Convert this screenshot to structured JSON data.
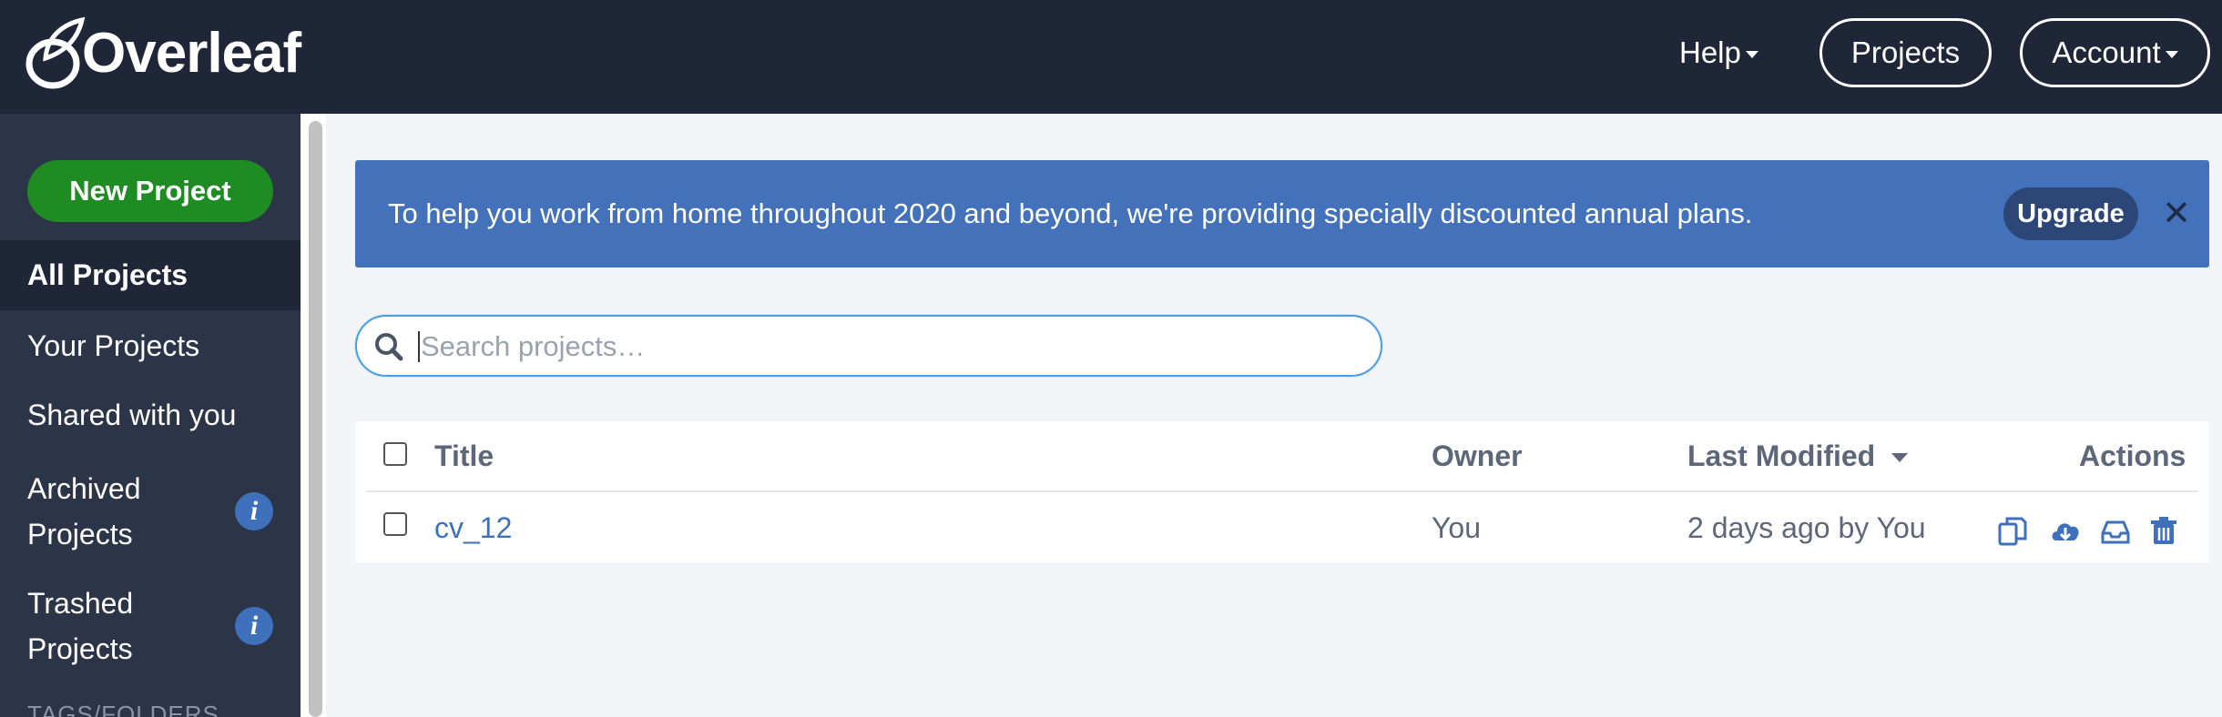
{
  "header": {
    "logo_text": "Overleaf",
    "help_label": "Help",
    "projects_label": "Projects",
    "account_label": "Account"
  },
  "sidebar": {
    "new_project_label": "New Project",
    "items": [
      {
        "label": "All Projects",
        "active": true
      },
      {
        "label": "Your Projects"
      },
      {
        "label": "Shared with you"
      },
      {
        "label": "Archived Projects",
        "info": "i"
      },
      {
        "label": "Trashed Projects",
        "info": "i"
      }
    ],
    "tags_heading": "TAGS/FOLDERS"
  },
  "banner": {
    "text": "To help you work from home throughout 2020 and beyond, we're providing specially discounted annual plans.",
    "upgrade_label": "Upgrade",
    "close_glyph": "✕"
  },
  "search": {
    "placeholder": "Search projects…",
    "value": ""
  },
  "table": {
    "columns": [
      "Title",
      "Owner",
      "Last Modified",
      "Actions"
    ],
    "rows": [
      {
        "title": "cv_12",
        "owner": "You",
        "last_modified": "2 days ago by You",
        "actions": [
          "copy-icon",
          "download-icon",
          "archive-icon",
          "trash-icon"
        ]
      }
    ]
  },
  "colors": {
    "header_bg": "#1f2638",
    "sidebar_bg": "#2c3548",
    "new_project_green": "#1f8c23",
    "banner_blue": "#4372bb",
    "link_blue": "#3e70bb"
  }
}
